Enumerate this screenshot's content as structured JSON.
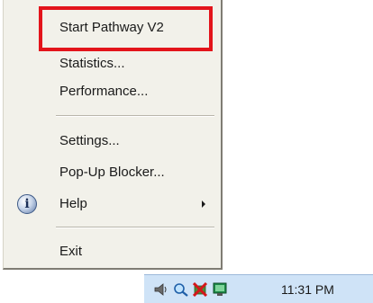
{
  "menu": {
    "items": [
      {
        "label": "Start Pathway V2"
      },
      {
        "label": "Statistics..."
      },
      {
        "label": "Performance..."
      },
      {
        "label": "Settings..."
      },
      {
        "label": "Pop-Up Blocker..."
      },
      {
        "label": "Help"
      },
      {
        "label": "Exit"
      }
    ]
  },
  "tray": {
    "clock": "11:31 PM",
    "icons": [
      "speaker-icon",
      "search-icon",
      "network-disabled-icon",
      "monitor-icon"
    ]
  },
  "colors": {
    "highlight_border": "#e3141b",
    "menu_background": "#f2f1ea",
    "tray_background": "#cfe3f7"
  }
}
